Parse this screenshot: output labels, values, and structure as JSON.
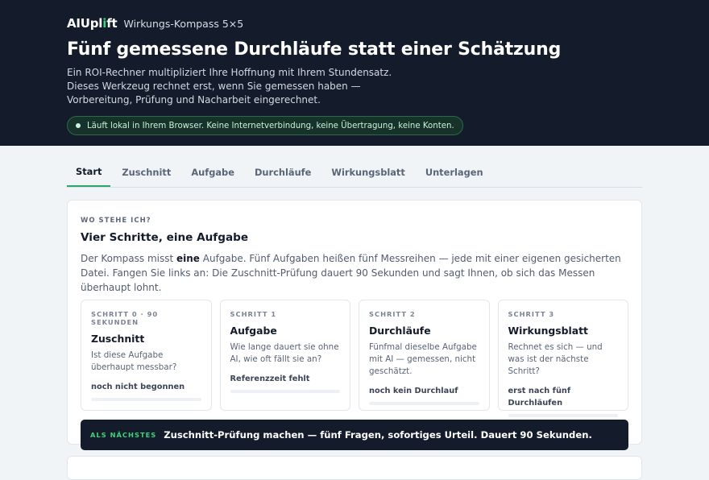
{
  "header": {
    "logo_main": "AIUpl",
    "logo_accent": "i",
    "logo_tail": "ft",
    "product": "Wirkungs-Kompass 5×5",
    "title": "Fünf gemessene Durchläufe statt einer Schätzung",
    "subtitle": "Ein ROI-Rechner multipliziert Ihre Hoffnung mit Ihrem Stundensatz. Dieses Werkzeug rechnet erst, wenn Sie gemessen haben — Vorbereitung, Prüfung und Nacharbeit eingerechnet.",
    "privacy_note": "Läuft lokal in Ihrem Browser. Keine Internetverbindung, keine Übertragung, keine Konten."
  },
  "tabs": [
    {
      "label": "Start",
      "active": true
    },
    {
      "label": "Zuschnitt",
      "active": false
    },
    {
      "label": "Aufgabe",
      "active": false
    },
    {
      "label": "Durchläufe",
      "active": false
    },
    {
      "label": "Wirkungsblatt",
      "active": false
    },
    {
      "label": "Unterlagen",
      "active": false
    }
  ],
  "overview": {
    "eyebrow": "WO STEHE ICH?",
    "title": "Vier Schritte, eine Aufgabe",
    "lead_1": "Der Kompass misst ",
    "lead_bold": "eine",
    "lead_2": " Aufgabe. Fünf Aufgaben heißen fünf Messreihen — jede mit einer eigenen gesicherten Datei. Fangen Sie links an: Die Zuschnitt-Prüfung dauert 90 Sekunden und sagt Ihnen, ob sich das Messen überhaupt lohnt."
  },
  "steps": [
    {
      "label": "SCHRITT 0 · 90 SEKUNDEN",
      "title": "Zuschnitt",
      "desc": "Ist diese Aufgabe überhaupt messbar?",
      "status": "noch nicht begonnen",
      "progress": 0
    },
    {
      "label": "SCHRITT 1",
      "title": "Aufgabe",
      "desc": "Wie lange dauert sie ohne AI, wie oft fällt sie an?",
      "status": "Referenzzeit fehlt",
      "progress": 0
    },
    {
      "label": "SCHRITT 2",
      "title": "Durchläufe",
      "desc": "Fünfmal dieselbe Aufgabe mit AI — gemessen, nicht geschätzt.",
      "status": "noch kein Durchlauf",
      "progress": 0
    },
    {
      "label": "SCHRITT 3",
      "title": "Wirkungsblatt",
      "desc": "Rechnet es sich — und was ist der nächste Schritt?",
      "status": "erst nach fünf Durchläufen",
      "progress": 0
    }
  ],
  "next_step": {
    "tag": "ALS NÄCHSTES",
    "text": "Zuschnitt-Prüfung machen — fünf Fragen, sofortiges Urteil. Dauert 90 Sekunden."
  },
  "colors": {
    "accent": "#2aa86a",
    "dark": "#141c2b"
  }
}
